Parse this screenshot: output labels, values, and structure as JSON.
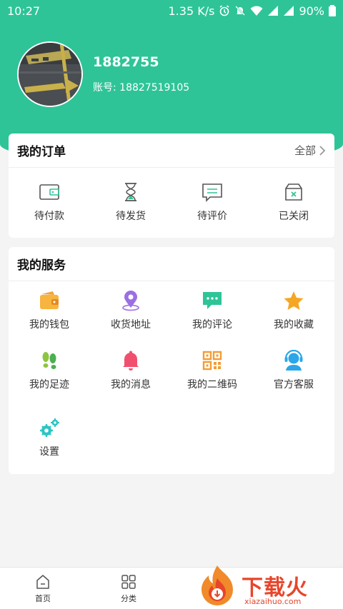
{
  "status_bar": {
    "time": "10:27",
    "net_speed": "1.35 K/s",
    "battery": "90%"
  },
  "profile": {
    "username": "1882755",
    "account_label": "账号:",
    "account_number": "18827519105"
  },
  "orders": {
    "title": "我的订单",
    "more_label": "全部",
    "items": [
      {
        "label": "待付款",
        "icon": "wallet-icon"
      },
      {
        "label": "待发货",
        "icon": "hourglass-icon"
      },
      {
        "label": "待评价",
        "icon": "comment-icon"
      },
      {
        "label": "已关闭",
        "icon": "closed-box-icon"
      }
    ]
  },
  "services": {
    "title": "我的服务",
    "items": [
      {
        "label": "我的钱包",
        "icon": "wallet-icon"
      },
      {
        "label": "收货地址",
        "icon": "location-pin-icon"
      },
      {
        "label": "我的评论",
        "icon": "chat-bubble-icon"
      },
      {
        "label": "我的收藏",
        "icon": "star-icon"
      },
      {
        "label": "我的足迹",
        "icon": "footprint-icon"
      },
      {
        "label": "我的消息",
        "icon": "bell-icon"
      },
      {
        "label": "我的二维码",
        "icon": "qr-code-icon"
      },
      {
        "label": "官方客服",
        "icon": "headset-icon"
      },
      {
        "label": "设置",
        "icon": "gears-icon"
      }
    ]
  },
  "tabbar": {
    "items": [
      {
        "label": "首页",
        "icon": "home-icon"
      },
      {
        "label": "分类",
        "icon": "grid-icon"
      }
    ]
  },
  "watermark": {
    "brand": "下载火",
    "url": "xiazaihuo.com"
  },
  "colors": {
    "brand_green": "#2ec497",
    "page_bg": "#f4f4f4"
  }
}
